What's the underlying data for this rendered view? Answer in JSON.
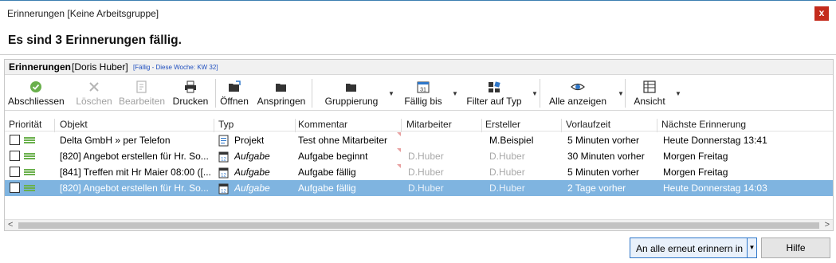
{
  "window": {
    "title": "Erinnerungen [Keine Arbeitsgruppe]",
    "close_label": "x"
  },
  "heading": "Es sind 3 Erinnerungen fällig.",
  "panel": {
    "title": "Erinnerungen",
    "user": "[Doris Huber]",
    "info": "[Fällig - Diese Woche: KW 32]"
  },
  "toolbar": {
    "abschliessen": "Abschliessen",
    "loeschen": "Löschen",
    "bearbeiten": "Bearbeiten",
    "drucken": "Drucken",
    "oeffnen": "Öffnen",
    "anspringen": "Anspringen",
    "gruppierung": "Gruppierung",
    "faellig_bis": "Fällig bis",
    "filter": "Filter auf Typ",
    "alle_anzeigen": "Alle anzeigen",
    "ansicht": "Ansicht"
  },
  "columns": [
    "Priorität",
    "Objekt",
    "Typ",
    "Kommentar",
    "Mitarbeiter",
    "Ersteller",
    "Vorlaufzeit",
    "Nächste Erinnerung"
  ],
  "rows": [
    {
      "objekt": "Delta GmbH » per Telefon",
      "typ": "Projekt",
      "kommentar": "Test ohne Mitarbeiter",
      "mitarbeiter": "",
      "ersteller": "M.Beispiel",
      "vorlaufzeit": "5 Minuten vorher",
      "naechste": "Heute Donnerstag 13:41"
    },
    {
      "objekt": "[820] Angebot erstellen für Hr. So...",
      "typ": "Aufgabe",
      "kommentar": "Aufgabe beginnt",
      "mitarbeiter": "D.Huber",
      "ersteller": "D.Huber",
      "vorlaufzeit": "30 Minuten vorher",
      "naechste": "Morgen Freitag"
    },
    {
      "objekt": "[841] Treffen mit Hr Maier 08:00 ([...",
      "typ": "Aufgabe",
      "kommentar": "Aufgabe fällig",
      "mitarbeiter": "D.Huber",
      "ersteller": "D.Huber",
      "vorlaufzeit": "5 Minuten vorher",
      "naechste": "Morgen Freitag"
    },
    {
      "objekt": "[820] Angebot erstellen für Hr. So...",
      "typ": "Aufgabe",
      "kommentar": "Aufgabe fällig",
      "mitarbeiter": "D.Huber",
      "ersteller": "D.Huber",
      "vorlaufzeit": "2 Tage vorher",
      "naechste": "Heute Donnerstag 14:03"
    }
  ],
  "scroll": {
    "left": "<",
    "right": ">"
  },
  "buttons": {
    "remind_all": "An alle erneut erinnern in",
    "help": "Hilfe"
  },
  "colors": {
    "selection": "#7fb4e0",
    "accent_border": "#2f77c9",
    "priority_green": "#6ab04c",
    "close_red": "#c42b1c"
  }
}
